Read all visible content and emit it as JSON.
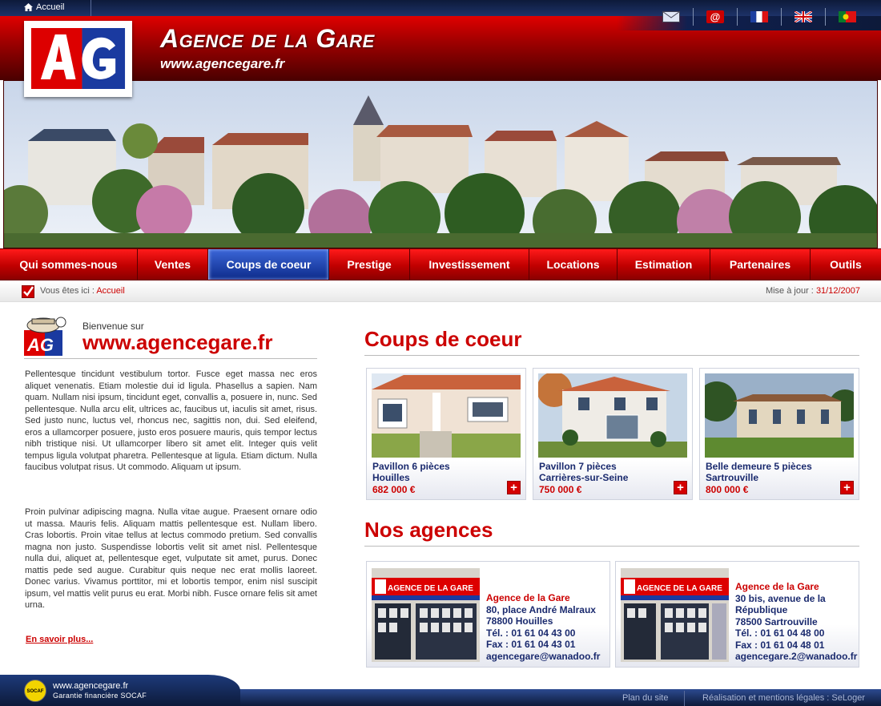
{
  "topbar": {
    "home_label": "Accueil",
    "home_icon": "home-icon"
  },
  "header": {
    "title": "Agence de la Gare",
    "url": "www.agencegare.fr",
    "icons": [
      "mail-icon",
      "at-icon",
      "flag-fr-icon",
      "flag-uk-icon",
      "flag-pt-icon"
    ]
  },
  "nav": {
    "items": [
      {
        "label": "Qui sommes-nous",
        "active": false
      },
      {
        "label": "Ventes",
        "active": false
      },
      {
        "label": "Coups de coeur",
        "active": true
      },
      {
        "label": "Prestige",
        "active": false
      },
      {
        "label": "Investissement",
        "active": false
      },
      {
        "label": "Locations",
        "active": false
      },
      {
        "label": "Estimation",
        "active": false
      },
      {
        "label": "Partenaires",
        "active": false
      },
      {
        "label": "Outils",
        "active": false
      }
    ]
  },
  "breadcrumb": {
    "prefix": "Vous êtes ici :",
    "current": "Accueil"
  },
  "update": {
    "prefix": "Mise à jour :",
    "date": "31/12/2007"
  },
  "welcome": {
    "small": "Bienvenue sur",
    "url": "www.agencegare.fr",
    "para1": "Pellentesque tincidunt vestibulum tortor. Fusce eget massa nec eros aliquet venenatis. Etiam molestie dui id ligula. Phasellus a sapien. Nam quam. Nullam nisi ipsum, tincidunt eget, convallis a, posuere in, nunc. Sed pellentesque. Nulla arcu elit, ultrices ac, faucibus ut, iaculis sit amet, risus. Sed justo nunc, luctus vel, rhoncus nec, sagittis non, dui. Sed eleifend, eros a ullamcorper posuere, justo eros posuere mauris, quis tempor lectus nibh tristique nisi. Ut ullamcorper libero sit amet elit. Integer quis velit tempus ligula volutpat pharetra. Pellentesque at ligula. Etiam dictum. Nulla faucibus volutpat risus. Ut commodo. Aliquam ut ipsum.",
    "para2": "Proin pulvinar adipiscing magna. Nulla vitae augue. Praesent ornare odio ut massa. Mauris felis. Aliquam mattis pellentesque est. Nullam libero. Cras lobortis. Proin vitae tellus at lectus commodo pretium. Sed convallis magna non justo. Suspendisse lobortis velit sit amet nisl. Pellentesque nulla dui, aliquet at, pellentesque eget, vulputate sit amet, purus. Donec mattis pede sed augue. Curabitur quis neque nec erat mollis laoreet. Donec varius. Vivamus porttitor, mi et lobortis tempor, enim nisl suscipit ipsum, vel mattis velit purus eu erat. Morbi nibh. Fusce ornare felis sit amet urna.",
    "more": "En savoir plus..."
  },
  "coups": {
    "title": "Coups de coeur",
    "cards": [
      {
        "line1": "Pavillon 6 pièces",
        "line2": "Houilles",
        "price": "682 000 €"
      },
      {
        "line1": "Pavillon 7 pièces",
        "line2": "Carrières-sur-Seine",
        "price": "750 000 €"
      },
      {
        "line1": "Belle demeure 5 pièces",
        "line2": "Sartrouville",
        "price": "800 000 €"
      }
    ]
  },
  "agences": {
    "title": "Nos agences",
    "items": [
      {
        "name": "Agence de la Gare",
        "address1": "80, place André Malraux",
        "address2": "",
        "city": "78800 Houilles",
        "tel": "Tél. : 01 61 04 43 00",
        "fax": "Fax : 01 61 04 43 01",
        "email": "agencegare@wanadoo.fr"
      },
      {
        "name": "Agence de la Gare",
        "address1": "30 bis, avenue de la",
        "address2": "République",
        "city": "78500 Sartrouville",
        "tel": "Tél. : 01 61 04 48 00",
        "fax": "Fax : 01 61 04 48 01",
        "email": "agencegare.2@wanadoo.fr"
      }
    ],
    "sign_text": "AGENCE DE LA GARE"
  },
  "footer": {
    "badge": "SOCAF",
    "url": "www.agencegare.fr",
    "guarantee": "Garantie financière SOCAF",
    "plan": "Plan du site",
    "legal": "Réalisation et mentions légales : SeLoger"
  },
  "colors": {
    "brand_red": "#cc0000",
    "navy": "#1a2a6e",
    "active_nav": "#1f45b8"
  }
}
